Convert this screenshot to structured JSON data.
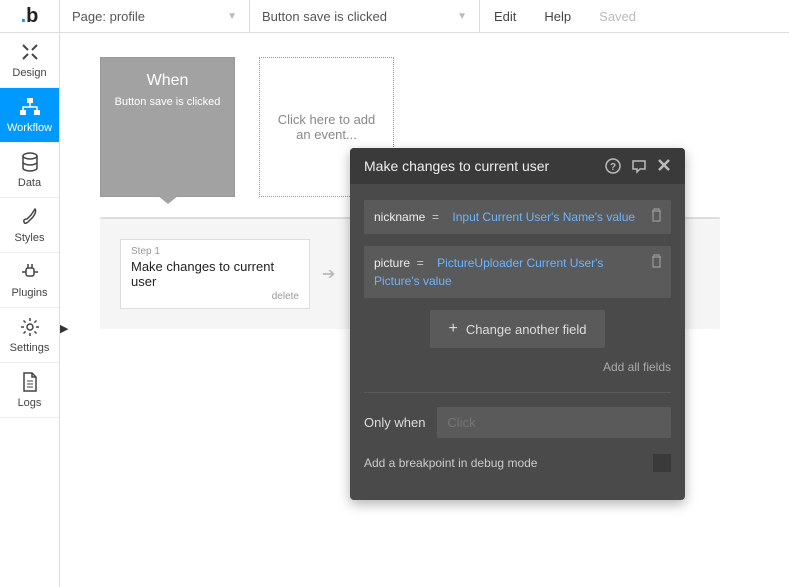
{
  "topbar": {
    "page_label": "Page: profile",
    "event_label": "Button save is clicked",
    "edit_label": "Edit",
    "help_label": "Help",
    "saved_label": "Saved"
  },
  "sidebar": {
    "items": [
      {
        "label": "Design"
      },
      {
        "label": "Workflow"
      },
      {
        "label": "Data"
      },
      {
        "label": "Styles"
      },
      {
        "label": "Plugins"
      },
      {
        "label": "Settings"
      },
      {
        "label": "Logs"
      }
    ]
  },
  "event": {
    "when_title": "When",
    "when_subtitle": "Button save is clicked",
    "add_event_text": "Click here to add an event..."
  },
  "steps": {
    "step1_label": "Step 1",
    "step1_title": "Make changes to current user",
    "step1_delete": "delete"
  },
  "panel": {
    "title": "Make changes to current user",
    "field1_name": "nickname",
    "field1_value": "Input Current User's Name's value",
    "field2_name": "picture",
    "field2_value": "PictureUploader Current User's Picture's value",
    "eq": "=",
    "change_btn": "Change another field",
    "add_all": "Add all fields",
    "only_when_label": "Only when",
    "only_when_placeholder": "Click",
    "breakpoint_label": "Add a breakpoint in debug mode"
  }
}
